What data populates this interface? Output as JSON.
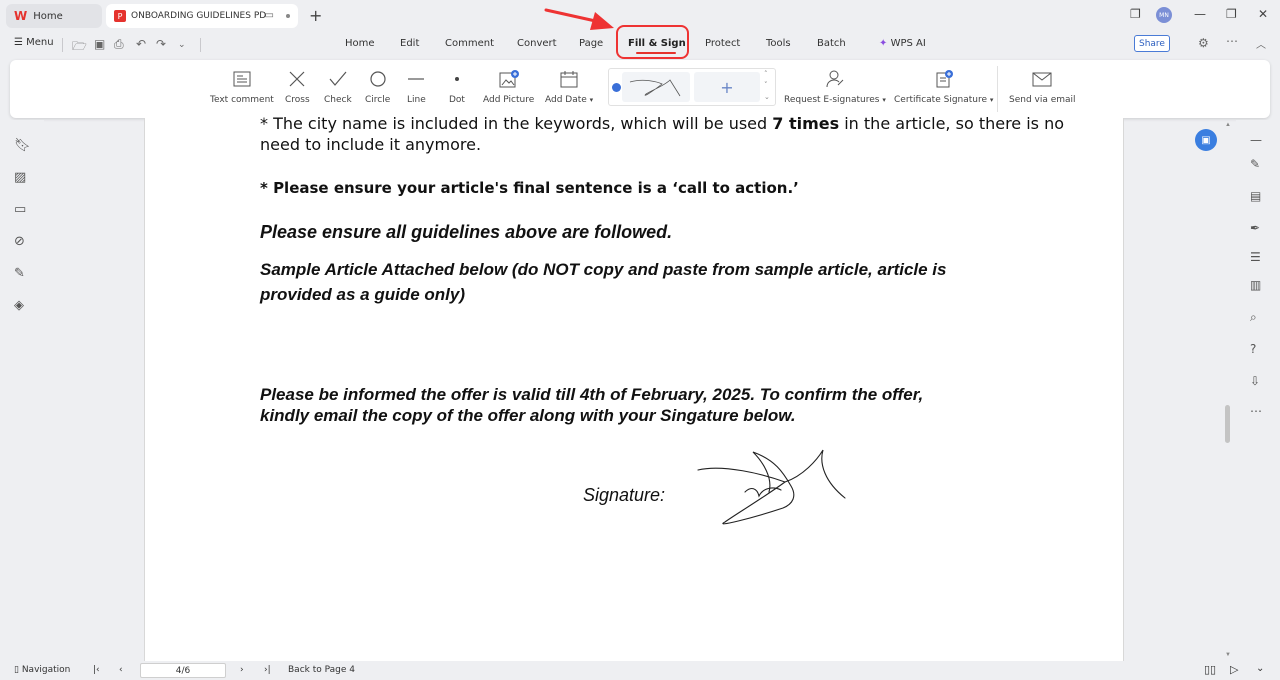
{
  "tabs": {
    "home": "Home",
    "document": "ONBOARDING GUIDELINES PD"
  },
  "window": {
    "avatar_initials": "MN"
  },
  "menubar": {
    "menu_label": "Menu",
    "tabs": [
      "Home",
      "Edit",
      "Comment",
      "Convert",
      "Page",
      "Fill & Sign",
      "Protect",
      "Tools",
      "Batch",
      "WPS AI"
    ],
    "active_tab": "Fill & Sign",
    "share_label": "Share"
  },
  "ribbon": {
    "text_comment": "Text comment",
    "cross": "Cross",
    "check": "Check",
    "circle": "Circle",
    "line": "Line",
    "dot": "Dot",
    "add_picture": "Add Picture",
    "add_date": "Add Date",
    "request_esignatures": "Request E-signatures",
    "certificate_signature": "Certificate Signature",
    "send_via_email": "Send via email",
    "add_signature": "+"
  },
  "document": {
    "line1": "* The city name is included in the keywords, which will be used ",
    "line1_bold": "7 times",
    "line1_end": " in the article, so there is no",
    "line2": "need to include it anymore.",
    "line3": "* Please ensure your article's final sentence is a ‘call to action.’",
    "line4": "Please ensure all guidelines above are followed.",
    "line5": "Sample Article Attached below (do NOT copy and paste from sample article, article is",
    "line6": "provided as a guide only)",
    "line7": "Please be informed the offer is valid till 4th of February, 2025. To confirm the offer,",
    "line8": "kindly email the copy of the offer along with your Singature below.",
    "signature_label": "Signature:"
  },
  "statusbar": {
    "navigation": "Navigation",
    "page_indicator": "4/6",
    "back_to_page": "Back to Page 4"
  },
  "colors": {
    "accent_red": "#e5322d",
    "highlight_red": "#e33333",
    "link_blue": "#3a7ee0",
    "wps_ai_purple": "#8a4de0"
  }
}
